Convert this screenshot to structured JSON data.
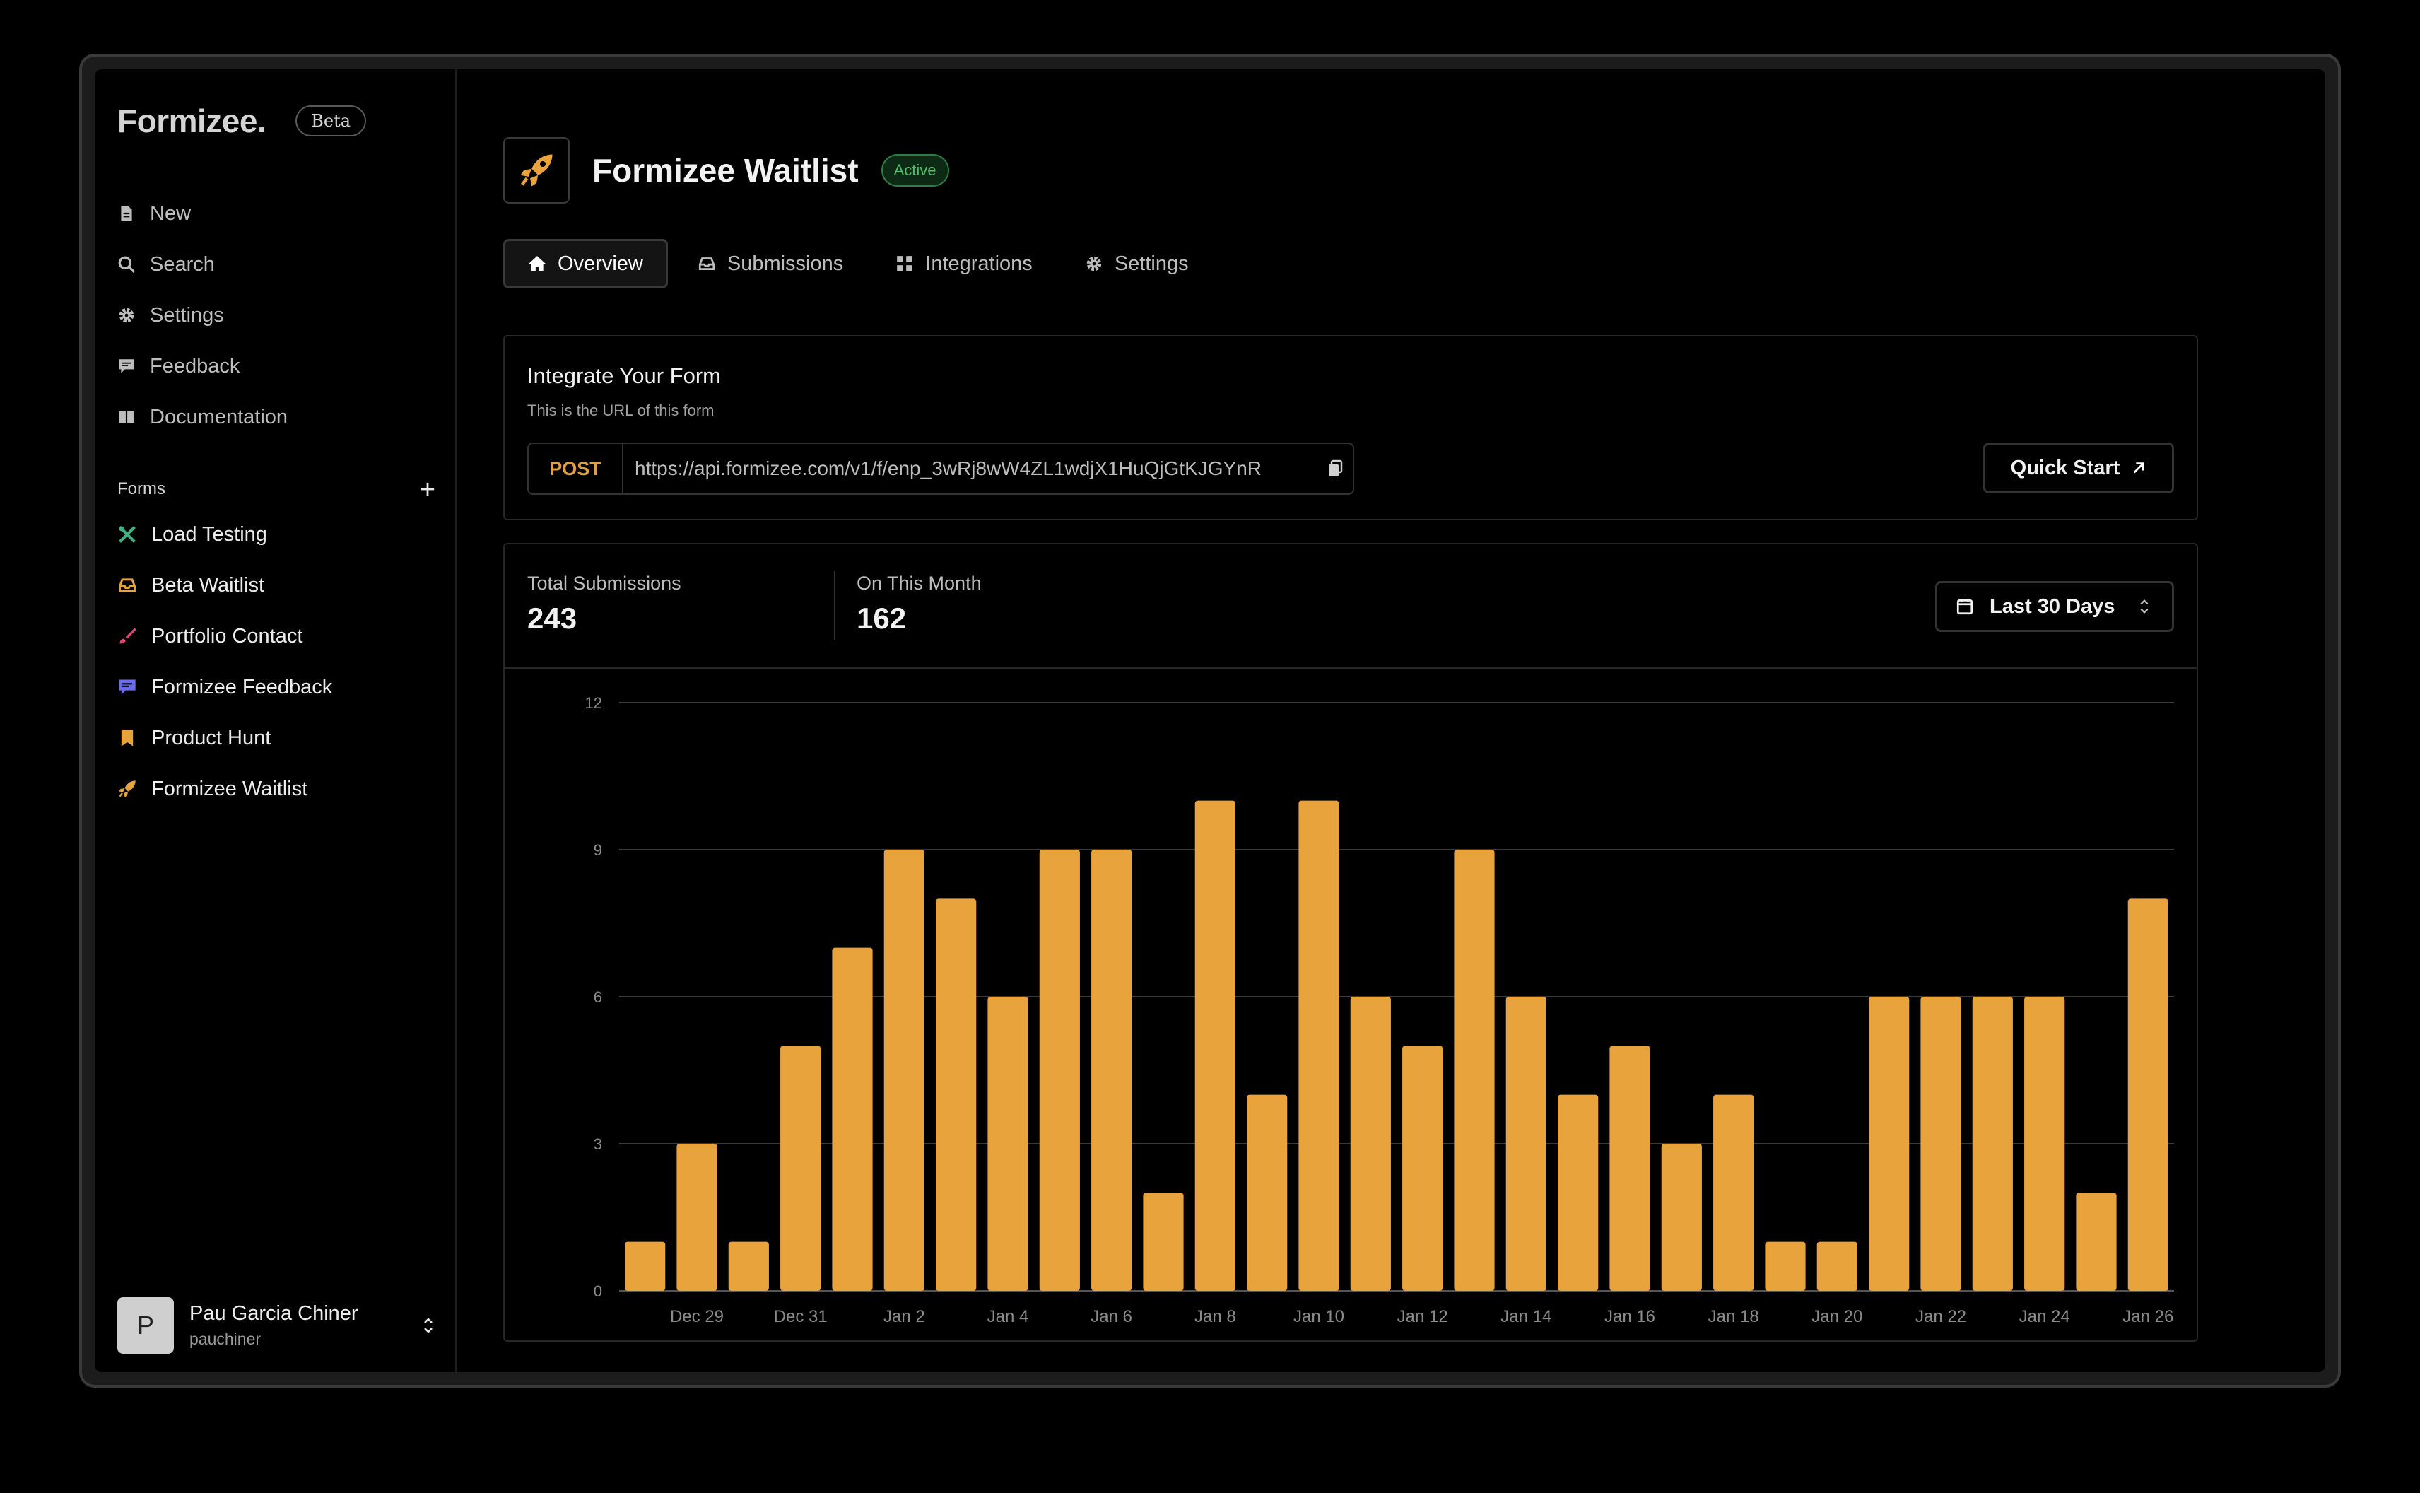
{
  "sidebar": {
    "logo": "Formizee.",
    "beta": "Beta",
    "nav": [
      {
        "label": "New",
        "icon": "document-icon"
      },
      {
        "label": "Search",
        "icon": "search-icon"
      },
      {
        "label": "Settings",
        "icon": "gear-icon"
      },
      {
        "label": "Feedback",
        "icon": "chat-icon"
      },
      {
        "label": "Documentation",
        "icon": "book-icon"
      }
    ],
    "forms_heading": "Forms",
    "forms": [
      {
        "label": "Load Testing",
        "icon": "tools-icon",
        "color": "#3fb27f"
      },
      {
        "label": "Beta Waitlist",
        "icon": "inbox-icon",
        "color": "#e8a33d"
      },
      {
        "label": "Portfolio Contact",
        "icon": "brush-icon",
        "color": "#e0457b"
      },
      {
        "label": "Formizee Feedback",
        "icon": "chat-icon",
        "color": "#6b6bf0"
      },
      {
        "label": "Product Hunt",
        "icon": "bookmark-icon",
        "color": "#e8a33d"
      },
      {
        "label": "Formizee Waitlist",
        "icon": "rocket-icon",
        "color": "#e8a33d"
      }
    ],
    "user": {
      "initial": "P",
      "name": "Pau Garcia Chiner",
      "handle": "pauchiner"
    }
  },
  "header": {
    "title": "Formizee Waitlist",
    "status": "Active"
  },
  "tabs": [
    {
      "label": "Overview",
      "icon": "home-icon",
      "active": true
    },
    {
      "label": "Submissions",
      "icon": "inbox-icon"
    },
    {
      "label": "Integrations",
      "icon": "grid-icon"
    },
    {
      "label": "Settings",
      "icon": "gear-icon"
    }
  ],
  "integrate": {
    "title": "Integrate Your Form",
    "subtitle": "This is the URL of this form",
    "method": "POST",
    "url": "https://api.formizee.com/v1/f/enp_3wRj8wW4ZL1wdjX1HuQjGtKJGYnR",
    "quick_start": "Quick Start"
  },
  "stats": {
    "total_label": "Total Submissions",
    "total_value": "243",
    "month_label": "On This Month",
    "month_value": "162",
    "range": "Last 30 Days"
  },
  "colors": {
    "accent": "#e8a33d",
    "active_badge": "#4fbf6a"
  },
  "chart_data": {
    "type": "bar",
    "categories": [
      "Dec 28",
      "Dec 29",
      "Dec 30",
      "Dec 31",
      "Jan 1",
      "Jan 2",
      "Jan 3",
      "Jan 4",
      "Jan 5",
      "Jan 6",
      "Jan 7",
      "Jan 8",
      "Jan 9",
      "Jan 10",
      "Jan 11",
      "Jan 12",
      "Jan 13",
      "Jan 14",
      "Jan 15",
      "Jan 16",
      "Jan 17",
      "Jan 18",
      "Jan 19",
      "Jan 20",
      "Jan 21",
      "Jan 22",
      "Jan 23",
      "Jan 24",
      "Jan 25",
      "Jan 26"
    ],
    "tick_labels": [
      "Dec 29",
      "Dec 31",
      "Jan 2",
      "Jan 4",
      "Jan 6",
      "Jan 8",
      "Jan 10",
      "Jan 12",
      "Jan 14",
      "Jan 16",
      "Jan 18",
      "Jan 20",
      "Jan 22",
      "Jan 24",
      "Jan 26"
    ],
    "values": [
      1,
      3,
      1,
      5,
      7,
      9,
      8,
      6,
      9,
      9,
      2,
      10,
      4,
      10,
      6,
      5,
      9,
      6,
      4,
      5,
      3,
      4,
      1,
      1,
      6,
      6,
      6,
      6,
      2,
      8
    ],
    "y_ticks": [
      0,
      3,
      6,
      9,
      12
    ],
    "ylim": [
      0,
      12
    ],
    "grid": true,
    "color": "#e8a33d"
  }
}
